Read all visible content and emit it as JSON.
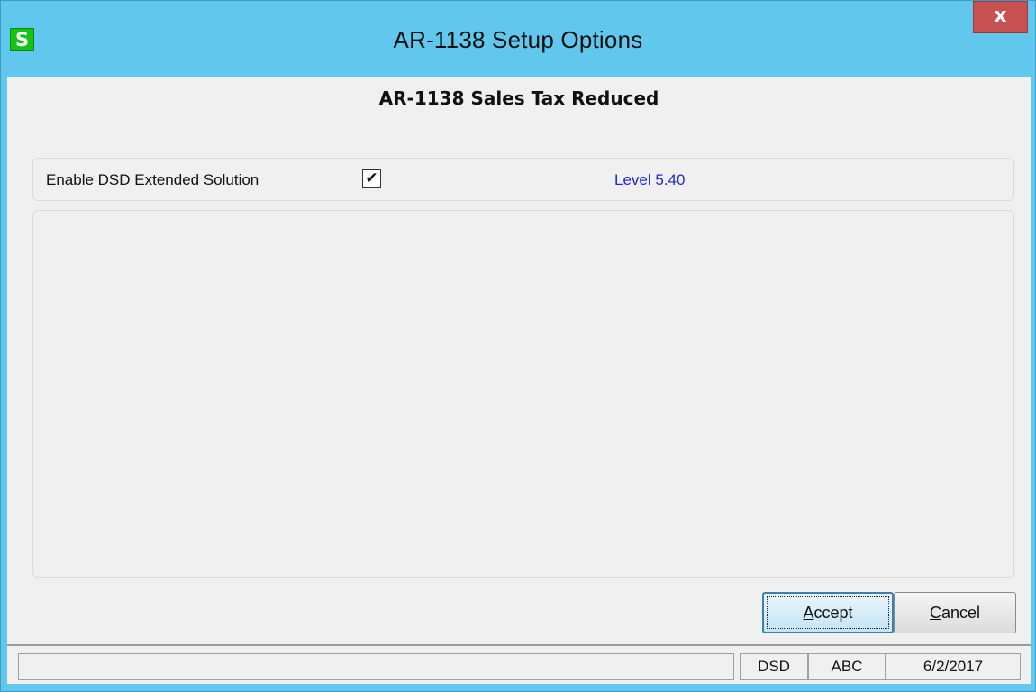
{
  "window": {
    "title": "AR-1138 Setup Options",
    "app_icon_glyph": "S",
    "close_glyph": "x",
    "colors": {
      "titlebar": "#62c7ec",
      "close_button": "#c75050",
      "app_icon": "#14c414",
      "level_text": "#1f2ad6"
    }
  },
  "header": {
    "title": "AR-1138 Sales Tax Reduced"
  },
  "options": {
    "enable_label": "Enable DSD Extended Solution",
    "enable_checked": true,
    "check_glyph": "✔",
    "level_label": "Level  5.40"
  },
  "buttons": {
    "accept": {
      "mnemonic": "A",
      "rest": "ccept"
    },
    "cancel": {
      "mnemonic": "C",
      "rest": "ancel"
    }
  },
  "statusbar": {
    "message": "",
    "user": "DSD",
    "company": "ABC",
    "date": "6/2/2017"
  }
}
